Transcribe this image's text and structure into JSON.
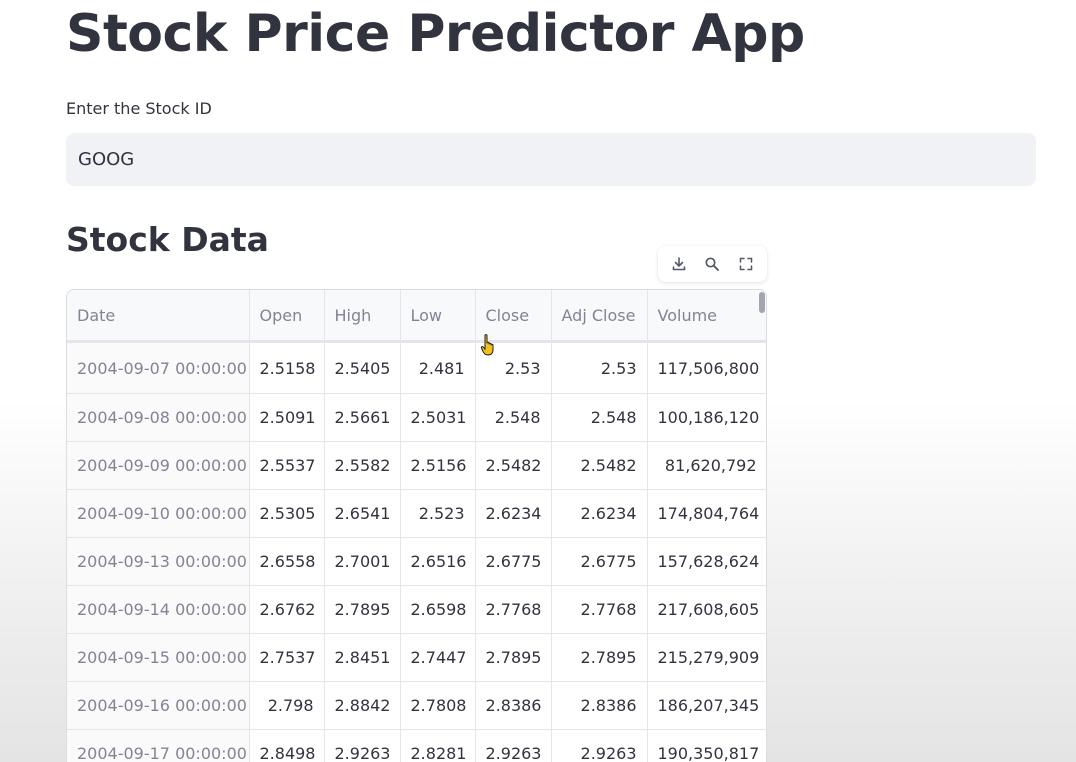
{
  "app": {
    "title": "Stock Price Predictor App"
  },
  "stock_input": {
    "label": "Enter the Stock ID",
    "value": "GOOG"
  },
  "stock_data": {
    "heading": "Stock Data",
    "toolbar": {
      "icons": [
        "download-icon",
        "search-icon",
        "fullscreen-icon"
      ]
    },
    "columns": [
      "Date",
      "Open",
      "High",
      "Low",
      "Close",
      "Adj Close",
      "Volume"
    ],
    "rows": [
      [
        "2004-09-07 00:00:00",
        "2.5158",
        "2.5405",
        "2.481",
        "2.53",
        "2.53",
        "117,506,800"
      ],
      [
        "2004-09-08 00:00:00",
        "2.5091",
        "2.5661",
        "2.5031",
        "2.548",
        "2.548",
        "100,186,120"
      ],
      [
        "2004-09-09 00:00:00",
        "2.5537",
        "2.5582",
        "2.5156",
        "2.5482",
        "2.5482",
        "81,620,792"
      ],
      [
        "2004-09-10 00:00:00",
        "2.5305",
        "2.6541",
        "2.523",
        "2.6234",
        "2.6234",
        "174,804,764"
      ],
      [
        "2004-09-13 00:00:00",
        "2.6558",
        "2.7001",
        "2.6516",
        "2.6775",
        "2.6775",
        "157,628,624"
      ],
      [
        "2004-09-14 00:00:00",
        "2.6762",
        "2.7895",
        "2.6598",
        "2.7768",
        "2.7768",
        "217,608,605"
      ],
      [
        "2004-09-15 00:00:00",
        "2.7537",
        "2.8451",
        "2.7447",
        "2.7895",
        "2.7895",
        "215,279,909"
      ],
      [
        "2004-09-16 00:00:00",
        "2.798",
        "2.8842",
        "2.7808",
        "2.8386",
        "2.8386",
        "186,207,345"
      ],
      [
        "2004-09-17 00:00:00",
        "2.8498",
        "2.9263",
        "2.8281",
        "2.9263",
        "2.9263",
        "190,350,817"
      ]
    ]
  }
}
